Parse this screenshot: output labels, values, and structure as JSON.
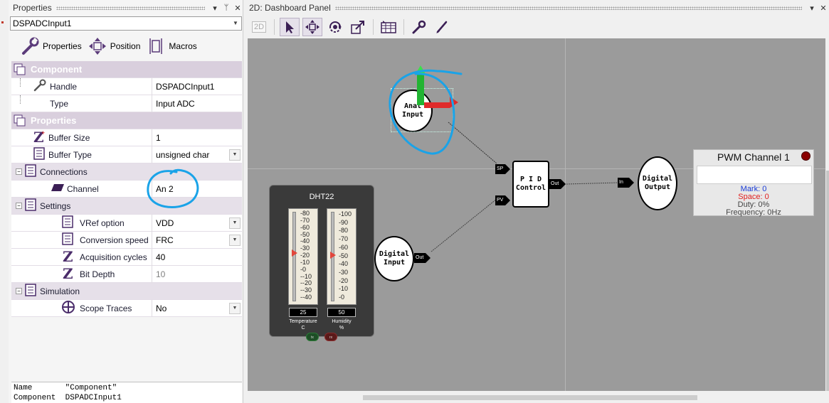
{
  "properties_panel": {
    "title": "Properties",
    "selected_component": "DSPADCInput1",
    "tabs": [
      {
        "label": "Properties",
        "icon": "wrench-icon"
      },
      {
        "label": "Position",
        "icon": "move-icon"
      },
      {
        "label": "Macros",
        "icon": "macro-icon"
      }
    ],
    "sections": {
      "component": {
        "title": "Component",
        "rows": [
          {
            "label": "Handle",
            "value": "DSPADCInput1"
          },
          {
            "label": "Type",
            "value": "Input ADC"
          }
        ]
      },
      "properties": {
        "title": "Properties",
        "rows": [
          {
            "label": "Buffer Size",
            "value": "1"
          },
          {
            "label": "Buffer Type",
            "value": "unsigned char"
          }
        ]
      },
      "connections": {
        "title": "Connections",
        "rows": [
          {
            "label": "Channel",
            "value": "An 2"
          }
        ]
      },
      "settings": {
        "title": "Settings",
        "rows": [
          {
            "label": "VRef option",
            "value": "VDD"
          },
          {
            "label": "Conversion speed",
            "value": "FRC"
          },
          {
            "label": "Acquisition cycles",
            "value": "40"
          },
          {
            "label": "Bit Depth",
            "value": "10"
          }
        ]
      },
      "simulation": {
        "title": "Simulation",
        "rows": [
          {
            "label": "Scope Traces",
            "value": "No"
          }
        ]
      }
    },
    "status": {
      "line1_key": "Name",
      "line1_val": "\"Component\"",
      "line2_key": "Component",
      "line2_val": "DSPADCInput1"
    }
  },
  "dashboard_panel": {
    "title": "2D: Dashboard Panel",
    "toolbar": {
      "mode_label": "2D"
    },
    "nodes": {
      "analog_input": "Anal\nInput",
      "pid_control": "P I D\nControl",
      "digital_input": "Digital\nInput",
      "digital_output": "Digital\nOutput"
    },
    "pins": {
      "sp": "SP",
      "pv": "PV",
      "out1": "Out",
      "out2": "Out",
      "in": "In"
    },
    "dht22": {
      "title": "DHT22",
      "temp_scale": [
        "80",
        "70",
        "60",
        "50",
        "40",
        "30",
        "20",
        "10",
        "0",
        "-10",
        "-20",
        "-30",
        "-40"
      ],
      "hum_scale": [
        "100",
        "90",
        "80",
        "70",
        "60",
        "50",
        "40",
        "30",
        "20",
        "10",
        "0"
      ],
      "temp_value": "25",
      "temp_label": "Temperature",
      "temp_unit": "C",
      "hum_value": "50",
      "hum_label": "Humidity",
      "hum_unit": "%",
      "led1": "tx",
      "led2": "rx"
    },
    "pwm": {
      "title": "PWM Channel 1",
      "mark": "Mark: 0",
      "space": "Space: 0",
      "duty": "Duty: 0%",
      "frequency": "Frequency: 0Hz"
    }
  }
}
